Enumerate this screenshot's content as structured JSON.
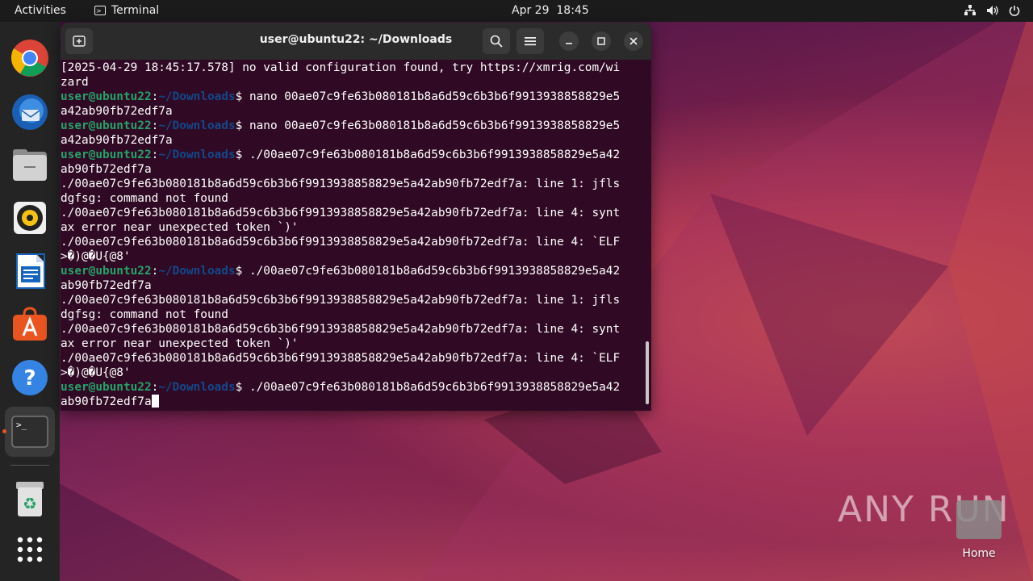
{
  "topbar": {
    "activities": "Activities",
    "app_name": "Terminal",
    "date": "Apr 29",
    "time": "18:45"
  },
  "dock": {
    "items": [
      {
        "name": "chrome",
        "icon": "chrome-icon"
      },
      {
        "name": "thunderbird",
        "icon": "thunderbird-icon"
      },
      {
        "name": "files",
        "icon": "files-icon"
      },
      {
        "name": "rhythmbox",
        "icon": "rhythmbox-icon"
      },
      {
        "name": "libreoffice-writer",
        "icon": "writer-icon"
      },
      {
        "name": "app-center",
        "icon": "app-center-icon"
      },
      {
        "name": "help",
        "icon": "help-icon"
      },
      {
        "name": "terminal",
        "icon": "terminal-icon",
        "active": true
      },
      {
        "name": "trash",
        "icon": "trash-icon"
      },
      {
        "name": "show-apps",
        "icon": "apps-grid-icon"
      }
    ]
  },
  "terminal": {
    "title": "user@ubuntu22: ~/Downloads",
    "prompt_user": "user@ubuntu22",
    "prompt_sep": ":",
    "prompt_path": "~/Downloads",
    "prompt_dollar": "$ ",
    "lines": [
      {
        "type": "out",
        "text": "[2025-04-29 18:45:17.578] no valid configuration found, try https://xmrig.com/wi"
      },
      {
        "type": "out",
        "text": "zard"
      },
      {
        "type": "cmd",
        "text": "nano 00ae07c9fe63b080181b8a6d59c6b3b6f9913938858829e5"
      },
      {
        "type": "out",
        "text": "a42ab90fb72edf7a"
      },
      {
        "type": "cmd",
        "text": "nano 00ae07c9fe63b080181b8a6d59c6b3b6f9913938858829e5"
      },
      {
        "type": "out",
        "text": "a42ab90fb72edf7a"
      },
      {
        "type": "cmd",
        "text": "./00ae07c9fe63b080181b8a6d59c6b3b6f9913938858829e5a42"
      },
      {
        "type": "out",
        "text": "ab90fb72edf7a"
      },
      {
        "type": "out",
        "text": "./00ae07c9fe63b080181b8a6d59c6b3b6f9913938858829e5a42ab90fb72edf7a: line 1: jfls"
      },
      {
        "type": "out",
        "text": "dgfsg: command not found"
      },
      {
        "type": "out",
        "text": "./00ae07c9fe63b080181b8a6d59c6b3b6f9913938858829e5a42ab90fb72edf7a: line 4: synt"
      },
      {
        "type": "out",
        "text": "ax error near unexpected token `)'"
      },
      {
        "type": "out",
        "text": "./00ae07c9fe63b080181b8a6d59c6b3b6f9913938858829e5a42ab90fb72edf7a: line 4: `ELF"
      },
      {
        "type": "out",
        "text": ">�)@�U{@8'"
      },
      {
        "type": "cmd",
        "text": "./00ae07c9fe63b080181b8a6d59c6b3b6f9913938858829e5a42"
      },
      {
        "type": "out",
        "text": "ab90fb72edf7a"
      },
      {
        "type": "out",
        "text": "./00ae07c9fe63b080181b8a6d59c6b3b6f9913938858829e5a42ab90fb72edf7a: line 1: jfls"
      },
      {
        "type": "out",
        "text": "dgfsg: command not found"
      },
      {
        "type": "out",
        "text": "./00ae07c9fe63b080181b8a6d59c6b3b6f9913938858829e5a42ab90fb72edf7a: line 4: synt"
      },
      {
        "type": "out",
        "text": "ax error near unexpected token `)'"
      },
      {
        "type": "out",
        "text": "./00ae07c9fe63b080181b8a6d59c6b3b6f9913938858829e5a42ab90fb72edf7a: line 4: `ELF"
      },
      {
        "type": "out",
        "text": ">�)@�U{@8'"
      },
      {
        "type": "cmd",
        "text": "./00ae07c9fe63b080181b8a6d59c6b3b6f9913938858829e5a42"
      },
      {
        "type": "cur",
        "text": "ab90fb72edf7a"
      }
    ]
  },
  "desktop": {
    "home_label": "Home",
    "watermark": "ANY RUN"
  },
  "colors": {
    "terminal_bg": "#300a24",
    "prompt_user": "#26a269",
    "prompt_path": "#12488b",
    "accent": "#e95420"
  }
}
